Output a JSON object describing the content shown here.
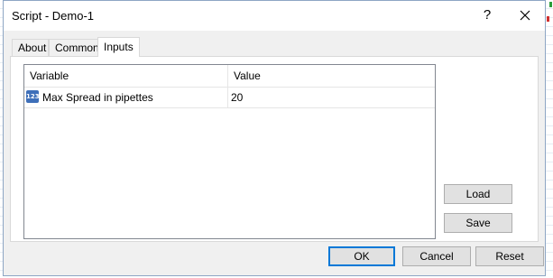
{
  "window": {
    "title": "Script - Demo-1",
    "help_label": "?",
    "close_icon": "close-icon"
  },
  "tabs": [
    {
      "label": "About",
      "active": false
    },
    {
      "label": "Common",
      "active": false
    },
    {
      "label": "Inputs",
      "active": true
    }
  ],
  "inputs_table": {
    "columns": [
      "Variable",
      "Value"
    ],
    "rows": [
      {
        "icon": "integer-type-icon",
        "icon_text": "123",
        "variable": "Max Spread in pipettes",
        "value": "20"
      }
    ]
  },
  "side_buttons": {
    "load_label": "Load",
    "save_label": "Save"
  },
  "footer_buttons": {
    "ok_label": "OK",
    "cancel_label": "Cancel",
    "reset_label": "Reset"
  },
  "colors": {
    "dialog_bg": "#f0f0f0",
    "accent": "#0078d7",
    "integer_icon": "#3e6fb9"
  }
}
